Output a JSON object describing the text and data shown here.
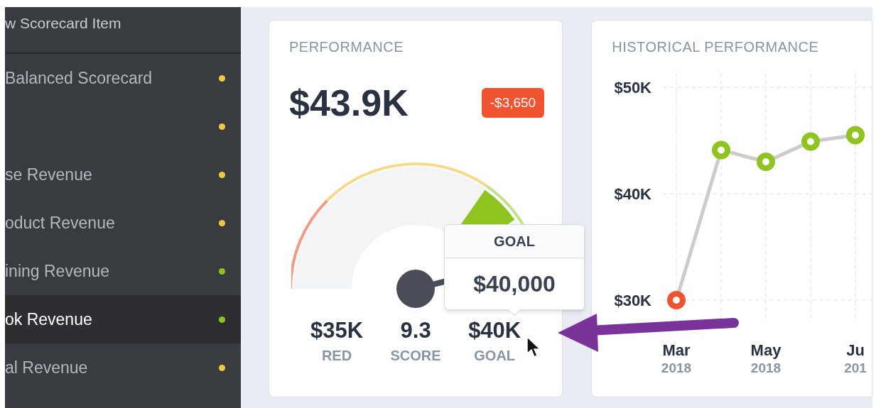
{
  "sidebar": {
    "header": "w Scorecard Item",
    "items": [
      {
        "label": "Balanced Scorecard",
        "color": "#f5c842",
        "selected": false
      },
      {
        "color": "#f5c842",
        "selected": false
      },
      {
        "label": "se Revenue",
        "color": "#f5c842",
        "selected": false
      },
      {
        "label": "oduct Revenue",
        "color": "#f5c842",
        "selected": false
      },
      {
        "label": "ining Revenue",
        "color": "#8fc31f",
        "selected": false
      },
      {
        "label": "ok Revenue",
        "color": "#8fc31f",
        "selected": true
      },
      {
        "label": "al Revenue",
        "color": "#f5c842",
        "selected": false
      }
    ]
  },
  "performance": {
    "title": "PERFORMANCE",
    "value": "$43.9K",
    "variance": "-$3,650",
    "stats": [
      {
        "value": "$35K",
        "label": "RED"
      },
      {
        "value": "9.3",
        "label": "SCORE"
      },
      {
        "value": "$40K",
        "label": "GOAL"
      }
    ],
    "tooltip": {
      "title": "GOAL",
      "value": "$40,000"
    }
  },
  "historical": {
    "title": "HISTORICAL PERFORMANCE",
    "chart_data": {
      "type": "line",
      "categories": [
        "Mar\n2018",
        null,
        "May\n2018",
        null,
        "Ju\n201"
      ],
      "ylim": [
        30000,
        50000
      ],
      "yticks": [
        {
          "value": 50000,
          "label": "$50K"
        },
        {
          "value": 40000,
          "label": "$40K"
        },
        {
          "value": 30000,
          "label": "$30K"
        }
      ],
      "grid": true,
      "series": [
        {
          "color": "#cccccc",
          "marker": "circle",
          "values": [
            30000,
            44100,
            43000,
            44900,
            45500
          ]
        }
      ]
    },
    "points": [
      {
        "color": "#f0532f"
      },
      {
        "color": "#8fc31f"
      },
      {
        "color": "#8fc31f"
      },
      {
        "color": "#8fc31f"
      },
      {
        "color": "#8fc31f"
      }
    ]
  }
}
